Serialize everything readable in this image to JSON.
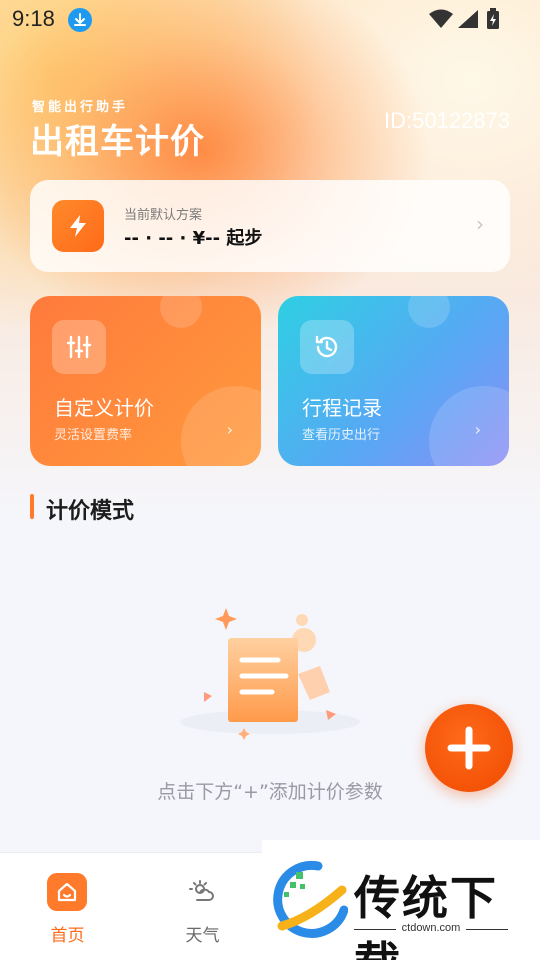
{
  "status_bar": {
    "time": "9:18",
    "icons": [
      "download-icon",
      "wifi-icon",
      "signal-icon",
      "battery-icon"
    ]
  },
  "header": {
    "subtitle": "智能出行助手",
    "title": "出租车计价",
    "user_id": "ID:50122873"
  },
  "plan_card": {
    "label": "当前默认方案",
    "value": "-- · -- · ¥-- 起步",
    "icon": "lightning-icon"
  },
  "feature_cards": [
    {
      "title": "自定义计价",
      "subtitle": "灵活设置费率",
      "icon": "sliders-icon"
    },
    {
      "title": "行程记录",
      "subtitle": "查看历史出行",
      "icon": "history-icon"
    }
  ],
  "section": {
    "title": "计价模式"
  },
  "empty_state": {
    "message": "点击下方“+”添加计价参数"
  },
  "fab": {
    "icon": "plus-icon"
  },
  "tab_bar": {
    "tabs": [
      {
        "label": "首页",
        "icon": "home-icon",
        "active": true
      },
      {
        "label": "天气",
        "icon": "weather-icon",
        "active": false
      }
    ]
  },
  "watermark": {
    "text": "传统下载",
    "url": "ctdown.com"
  },
  "colors": {
    "accent": "#ff6a1a",
    "card_orange": "#ff8a3c",
    "card_blue": "#4fb2f2",
    "background": "#f5f6fb"
  }
}
